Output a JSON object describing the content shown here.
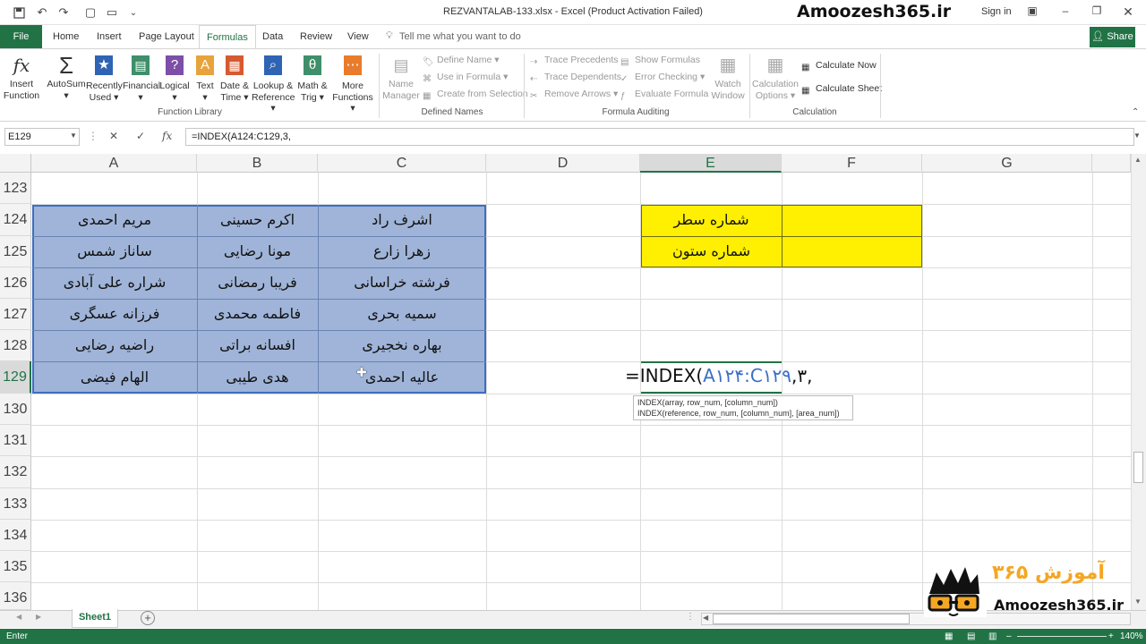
{
  "window": {
    "title": "REZVANTALAB-133.xlsx - Excel (Product Activation Failed)",
    "brand": "Amoozesh365.ir",
    "signin": "Sign in",
    "share": "Share"
  },
  "menu": {
    "file": "File",
    "tabs": [
      "Home",
      "Insert",
      "Page Layout",
      "Formulas",
      "Data",
      "Review",
      "View"
    ],
    "active_tab": "Formulas",
    "tell_me": "Tell me what you want to do"
  },
  "ribbon": {
    "function_library": {
      "label": "Function Library",
      "buttons": [
        {
          "line1": "Insert",
          "line2": "Function",
          "icon": "fx"
        },
        {
          "line1": "AutoSum",
          "line2": "▾",
          "icon": "Σ"
        },
        {
          "line1": "Recently",
          "line2": "Used ▾",
          "icon": "★"
        },
        {
          "line1": "Financial",
          "line2": "▾",
          "icon": "▤"
        },
        {
          "line1": "Logical",
          "line2": "▾",
          "icon": "?"
        },
        {
          "line1": "Text",
          "line2": "▾",
          "icon": "A"
        },
        {
          "line1": "Date &",
          "line2": "Time ▾",
          "icon": "▦"
        },
        {
          "line1": "Lookup &",
          "line2": "Reference ▾",
          "icon": "⌕"
        },
        {
          "line1": "Math &",
          "line2": "Trig ▾",
          "icon": "θ"
        },
        {
          "line1": "More",
          "line2": "Functions ▾",
          "icon": "⋯"
        }
      ]
    },
    "defined_names": {
      "label": "Defined Names",
      "name_manager": [
        "Name",
        "Manager"
      ],
      "define_name": "Define Name ▾",
      "use_in_formula": "Use in Formula ▾",
      "create_from_selection": "Create from Selection"
    },
    "formula_auditing": {
      "label": "Formula Auditing",
      "trace_precedents": "Trace Precedents",
      "trace_dependents": "Trace Dependents",
      "remove_arrows": "Remove Arrows ▾",
      "show_formulas": "Show Formulas",
      "error_checking": "Error Checking ▾",
      "evaluate_formula": "Evaluate Formula",
      "watch_window": [
        "Watch",
        "Window"
      ]
    },
    "calculation": {
      "label": "Calculation",
      "options": [
        "Calculation",
        "Options ▾"
      ],
      "calculate_now": "Calculate Now",
      "calculate_sheet": "Calculate Sheet"
    }
  },
  "formula_bar": {
    "name_box": "E129",
    "formula": "=INDEX(A124:C129,3,"
  },
  "columns": [
    "A",
    "B",
    "C",
    "D",
    "E",
    "F",
    "G"
  ],
  "rows": [
    "123",
    "124",
    "125",
    "126",
    "127",
    "128",
    "129",
    "130",
    "131",
    "132",
    "133",
    "134",
    "135",
    "136"
  ],
  "table": [
    [
      "مریم احمدی",
      "اکرم حسینی",
      "اشرف راد"
    ],
    [
      "ساناز شمس",
      "مونا رضایی",
      "زهرا زارع"
    ],
    [
      "شراره علی آبادی",
      "فریبا رمضانی",
      "فرشته خراسانی"
    ],
    [
      "فرزانه عسگری",
      "فاطمه محمدی",
      "سمیه بحری"
    ],
    [
      "راضیه رضایی",
      "افسانه براتی",
      "بهاره نخجیری"
    ],
    [
      "الهام فیضی",
      "هدی طیبی",
      "عالیه احمدی"
    ]
  ],
  "side_labels": [
    "شماره سطر",
    "شماره ستون"
  ],
  "cell_edit": {
    "prefix": "=INDEX(",
    "ref": "A۱۲۴:C۱۲۹",
    "suffix": ",۳,"
  },
  "tooltip": {
    "line1": "INDEX(array, row_num, [column_num])",
    "line2": "INDEX(reference, row_num, [column_num], [area_num])"
  },
  "sheet_tab": "Sheet1",
  "status": {
    "mode": "Enter",
    "zoom": "140%"
  },
  "logo": {
    "text_fa": "آموزش ۳۶۵"
  }
}
